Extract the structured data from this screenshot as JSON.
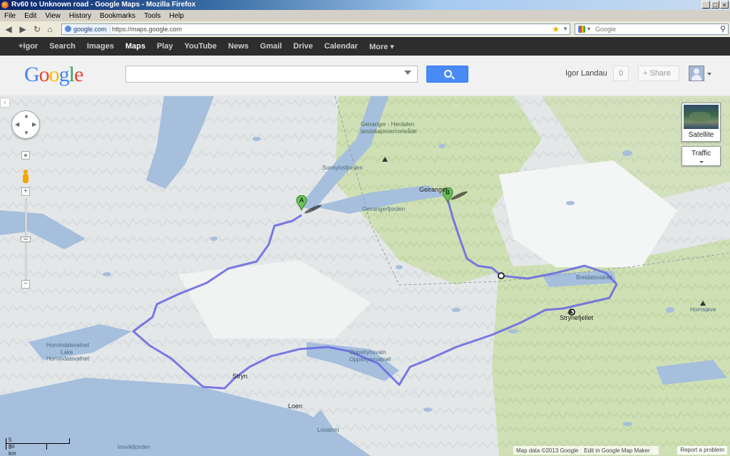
{
  "window": {
    "title": "Rv60 to Unknown road - Google Maps - Mozilla Firefox"
  },
  "menu": [
    "File",
    "Edit",
    "View",
    "History",
    "Bookmarks",
    "Tools",
    "Help"
  ],
  "nav": {
    "site_badge": "google.com",
    "url": "https://maps.google.com",
    "search_engine": "Google"
  },
  "gbar": [
    "+Igor",
    "Search",
    "Images",
    "Maps",
    "Play",
    "YouTube",
    "News",
    "Gmail",
    "Drive",
    "Calendar",
    "More ▾"
  ],
  "header": {
    "search_value": "",
    "user_name": "Igor Landau",
    "notifications": "0",
    "share_label": "+ Share"
  },
  "map": {
    "controls": {
      "satellite_label": "Satellite",
      "traffic_label": "Traffic"
    },
    "scale": {
      "miles": "5 mi",
      "km": "5 km"
    },
    "labels": {
      "geiranger_area": "Geiranger - Herdalen",
      "geiranger_area2": "landskapsvernområde",
      "sunnylvsfjorden": "Sunnylvsfjorden",
      "geiranger": "Geiranger",
      "geirangerfjorden": "Geirangerfjorden",
      "breidalsvatnet": "Breidalsvatnet",
      "strynefjellet": "Strynefjellet",
      "hornsjoeve": "Hornsjøve",
      "hornindalsvatnet": "Hornindalsvatnet",
      "lake": "Lake",
      "hornindalsvatnet2": "Hornindalsvatnet",
      "stryn": "Stryn",
      "loen": "Loen",
      "oppstrynsvatn": "Oppstrynsvatn",
      "oppstrynsvatnet": "Oppstrynsvatnet",
      "lovatnet": "Lovatnet",
      "innvikfjorden": "Innvikfjorden"
    },
    "markers": {
      "start": "A",
      "end": "B"
    },
    "footer": {
      "data": "Map data ©2013 Google",
      "edit": "Edit in Google Map Maker",
      "report": "Report a problem"
    },
    "colors": {
      "route": "#6c6ce0",
      "water": "#a5bfdd",
      "park": "#cfe0b5",
      "land": "#e9ecee",
      "marker": "#6ac259"
    }
  }
}
